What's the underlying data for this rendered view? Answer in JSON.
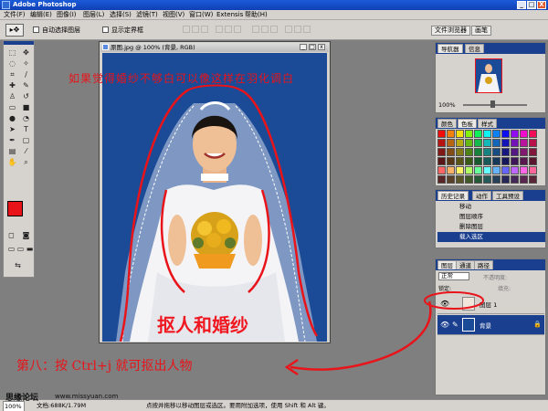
{
  "app": {
    "title": "Adobe Photoshop",
    "window_controls": [
      "_",
      "□",
      "X"
    ]
  },
  "menubar": {
    "items": [
      "文件(F)",
      "编辑(E)",
      "图像(I)",
      "图层(L)",
      "选择(S)",
      "滤镜(T)",
      "视图(V)",
      "窗口(W)",
      "Extensis",
      "帮助(H)"
    ]
  },
  "options": {
    "auto_select_label": "自动选择图层",
    "show_bounds_label": "显示定界框",
    "dock_tabs": [
      "文件浏览器",
      "画笔"
    ]
  },
  "document": {
    "title": "原图.jpg @ 100% (背景, RGB)",
    "controls": [
      "_",
      "□",
      "x"
    ]
  },
  "navigator": {
    "tabs": [
      "导航器",
      "信息"
    ],
    "zoom": "100%"
  },
  "swatches": {
    "tabs": [
      "颜色",
      "色板",
      "样式"
    ]
  },
  "history": {
    "tabs": [
      "历史记录",
      "动作",
      "工具预设"
    ],
    "items": [
      "移动",
      "图层顺序",
      "删除图层",
      "载入选区"
    ]
  },
  "layers": {
    "tabs": [
      "图层",
      "通道",
      "路径"
    ],
    "blend_mode": "正常",
    "opacity_label": "不透明度:",
    "lock_label": "锁定:",
    "fill_label": "填充:",
    "items": [
      {
        "name": "图层 1"
      },
      {
        "name": "背景"
      }
    ]
  },
  "annotations": {
    "top": "如果觉得婚纱不够白可以像这样在羽化调白",
    "center": "抠人和婚纱",
    "bottom": "第八：按 Ctrl+j 就可抠出人物"
  },
  "statusbar": {
    "zoom": "100%",
    "doc_info": "文档:688K/1.79M",
    "hint": "点按并拖移以移动图层或选区。要用附加选项，使用 Shift 和 Alt 键。",
    "watermark": "思缘论坛",
    "site": "www.missyuan.com"
  },
  "colors": {
    "foreground": "#e8141a",
    "background": "#ffffff",
    "annotation": "#e8141a",
    "canvas_bg": "#1b4a96",
    "title_bar": "#1c5bd8"
  }
}
